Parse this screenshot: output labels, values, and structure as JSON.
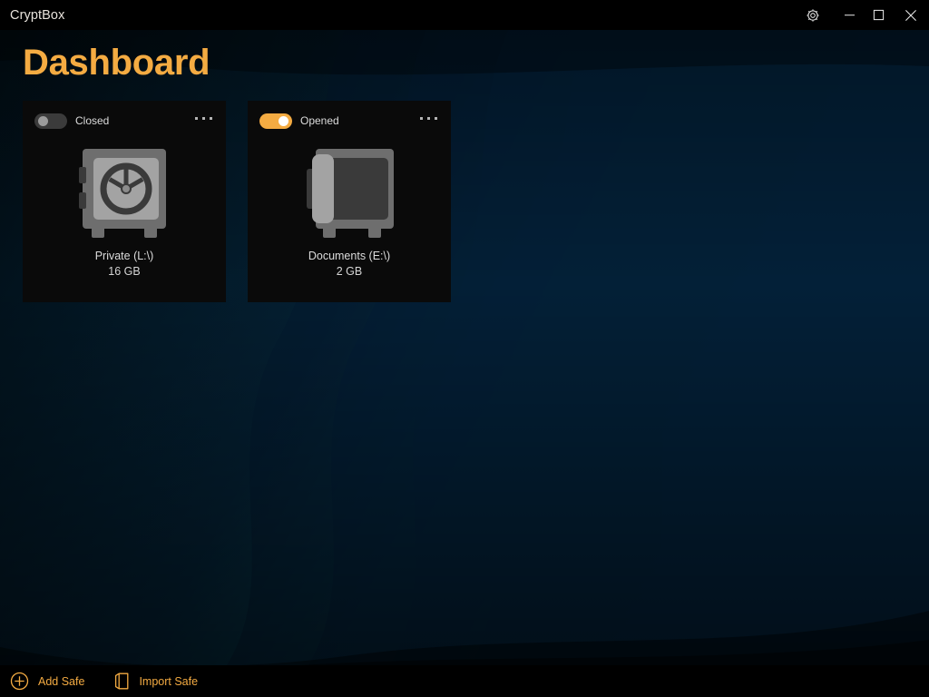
{
  "window": {
    "app_title": "CryptBox",
    "controls": [
      {
        "name": "settings-gear",
        "icon": "gear-icon"
      },
      {
        "name": "minimize",
        "icon": "minimize-icon"
      },
      {
        "name": "maximize",
        "icon": "maximize-icon"
      },
      {
        "name": "close",
        "icon": "close-icon"
      }
    ]
  },
  "page": {
    "title": "Dashboard",
    "accent_color": "#f4ab42",
    "background_color": "#01131c",
    "card_color": "#0a0a0a"
  },
  "safes": [
    {
      "state_label": "Closed",
      "state_on": false,
      "name": "Private (L:\\)",
      "size": "16 GB",
      "icon": "safe-closed-icon",
      "menu_icon": "ellipsis-icon"
    },
    {
      "state_label": "Opened",
      "state_on": true,
      "name": "Documents (E:\\)",
      "size": "2 GB",
      "icon": "safe-open-icon",
      "menu_icon": "ellipsis-icon"
    }
  ],
  "bottom_bar": {
    "add_safe_label": "Add Safe",
    "add_safe_icon": "plus-circle-icon",
    "import_safe_label": "Import Safe",
    "import_safe_icon": "open-door-icon"
  }
}
